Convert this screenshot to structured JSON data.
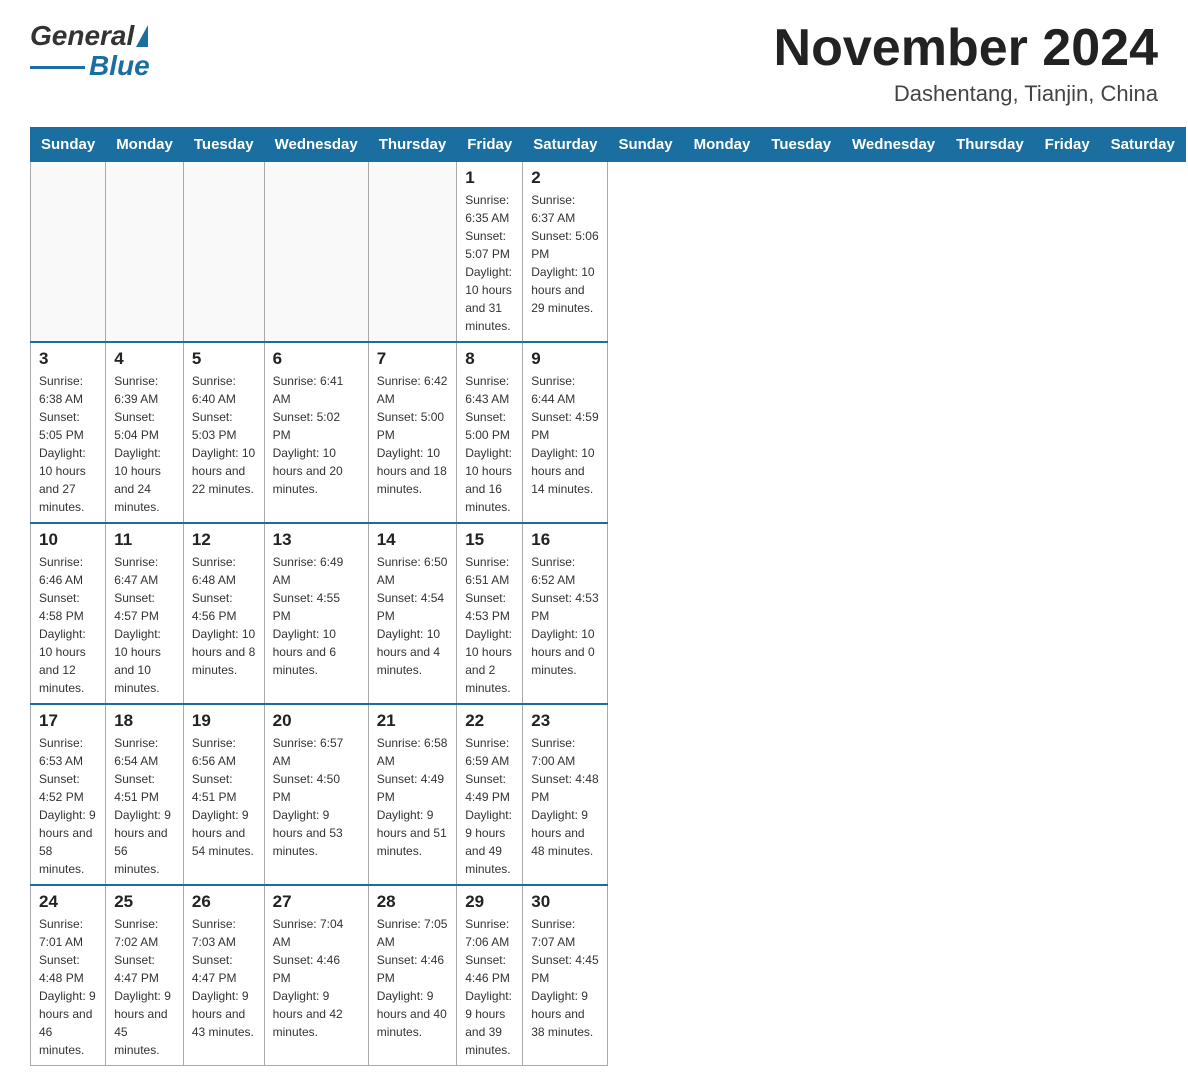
{
  "header": {
    "logo": {
      "text_general": "General",
      "text_blue": "Blue"
    },
    "title": "November 2024",
    "location": "Dashentang, Tianjin, China"
  },
  "days_of_week": [
    "Sunday",
    "Monday",
    "Tuesday",
    "Wednesday",
    "Thursday",
    "Friday",
    "Saturday"
  ],
  "weeks": [
    [
      {
        "day": "",
        "info": ""
      },
      {
        "day": "",
        "info": ""
      },
      {
        "day": "",
        "info": ""
      },
      {
        "day": "",
        "info": ""
      },
      {
        "day": "",
        "info": ""
      },
      {
        "day": "1",
        "info": "Sunrise: 6:35 AM\nSunset: 5:07 PM\nDaylight: 10 hours and 31 minutes."
      },
      {
        "day": "2",
        "info": "Sunrise: 6:37 AM\nSunset: 5:06 PM\nDaylight: 10 hours and 29 minutes."
      }
    ],
    [
      {
        "day": "3",
        "info": "Sunrise: 6:38 AM\nSunset: 5:05 PM\nDaylight: 10 hours and 27 minutes."
      },
      {
        "day": "4",
        "info": "Sunrise: 6:39 AM\nSunset: 5:04 PM\nDaylight: 10 hours and 24 minutes."
      },
      {
        "day": "5",
        "info": "Sunrise: 6:40 AM\nSunset: 5:03 PM\nDaylight: 10 hours and 22 minutes."
      },
      {
        "day": "6",
        "info": "Sunrise: 6:41 AM\nSunset: 5:02 PM\nDaylight: 10 hours and 20 minutes."
      },
      {
        "day": "7",
        "info": "Sunrise: 6:42 AM\nSunset: 5:00 PM\nDaylight: 10 hours and 18 minutes."
      },
      {
        "day": "8",
        "info": "Sunrise: 6:43 AM\nSunset: 5:00 PM\nDaylight: 10 hours and 16 minutes."
      },
      {
        "day": "9",
        "info": "Sunrise: 6:44 AM\nSunset: 4:59 PM\nDaylight: 10 hours and 14 minutes."
      }
    ],
    [
      {
        "day": "10",
        "info": "Sunrise: 6:46 AM\nSunset: 4:58 PM\nDaylight: 10 hours and 12 minutes."
      },
      {
        "day": "11",
        "info": "Sunrise: 6:47 AM\nSunset: 4:57 PM\nDaylight: 10 hours and 10 minutes."
      },
      {
        "day": "12",
        "info": "Sunrise: 6:48 AM\nSunset: 4:56 PM\nDaylight: 10 hours and 8 minutes."
      },
      {
        "day": "13",
        "info": "Sunrise: 6:49 AM\nSunset: 4:55 PM\nDaylight: 10 hours and 6 minutes."
      },
      {
        "day": "14",
        "info": "Sunrise: 6:50 AM\nSunset: 4:54 PM\nDaylight: 10 hours and 4 minutes."
      },
      {
        "day": "15",
        "info": "Sunrise: 6:51 AM\nSunset: 4:53 PM\nDaylight: 10 hours and 2 minutes."
      },
      {
        "day": "16",
        "info": "Sunrise: 6:52 AM\nSunset: 4:53 PM\nDaylight: 10 hours and 0 minutes."
      }
    ],
    [
      {
        "day": "17",
        "info": "Sunrise: 6:53 AM\nSunset: 4:52 PM\nDaylight: 9 hours and 58 minutes."
      },
      {
        "day": "18",
        "info": "Sunrise: 6:54 AM\nSunset: 4:51 PM\nDaylight: 9 hours and 56 minutes."
      },
      {
        "day": "19",
        "info": "Sunrise: 6:56 AM\nSunset: 4:51 PM\nDaylight: 9 hours and 54 minutes."
      },
      {
        "day": "20",
        "info": "Sunrise: 6:57 AM\nSunset: 4:50 PM\nDaylight: 9 hours and 53 minutes."
      },
      {
        "day": "21",
        "info": "Sunrise: 6:58 AM\nSunset: 4:49 PM\nDaylight: 9 hours and 51 minutes."
      },
      {
        "day": "22",
        "info": "Sunrise: 6:59 AM\nSunset: 4:49 PM\nDaylight: 9 hours and 49 minutes."
      },
      {
        "day": "23",
        "info": "Sunrise: 7:00 AM\nSunset: 4:48 PM\nDaylight: 9 hours and 48 minutes."
      }
    ],
    [
      {
        "day": "24",
        "info": "Sunrise: 7:01 AM\nSunset: 4:48 PM\nDaylight: 9 hours and 46 minutes."
      },
      {
        "day": "25",
        "info": "Sunrise: 7:02 AM\nSunset: 4:47 PM\nDaylight: 9 hours and 45 minutes."
      },
      {
        "day": "26",
        "info": "Sunrise: 7:03 AM\nSunset: 4:47 PM\nDaylight: 9 hours and 43 minutes."
      },
      {
        "day": "27",
        "info": "Sunrise: 7:04 AM\nSunset: 4:46 PM\nDaylight: 9 hours and 42 minutes."
      },
      {
        "day": "28",
        "info": "Sunrise: 7:05 AM\nSunset: 4:46 PM\nDaylight: 9 hours and 40 minutes."
      },
      {
        "day": "29",
        "info": "Sunrise: 7:06 AM\nSunset: 4:46 PM\nDaylight: 9 hours and 39 minutes."
      },
      {
        "day": "30",
        "info": "Sunrise: 7:07 AM\nSunset: 4:45 PM\nDaylight: 9 hours and 38 minutes."
      }
    ]
  ]
}
